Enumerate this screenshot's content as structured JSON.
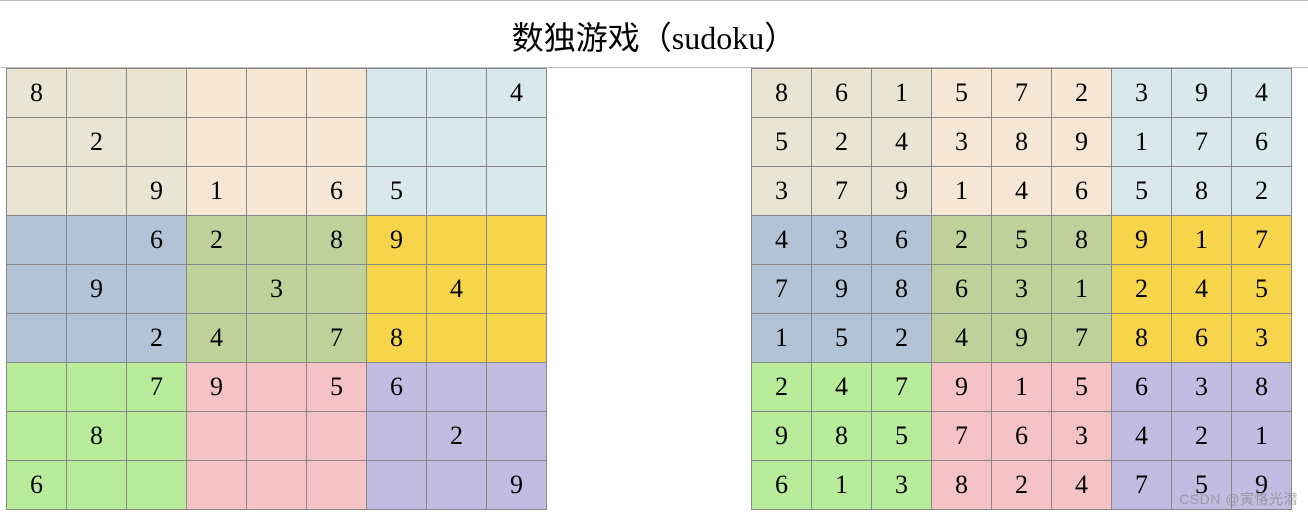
{
  "title": "数独游戏（sudoku）",
  "watermark": "CSDN @寅恪光潜",
  "colors": [
    "c0",
    "c1",
    "c2",
    "c3",
    "c4",
    "c5",
    "c6",
    "c7",
    "c8"
  ],
  "puzzle": [
    [
      "8",
      "",
      "",
      "",
      "",
      "",
      "",
      "",
      "4"
    ],
    [
      "",
      "2",
      "",
      "",
      "",
      "",
      "",
      "",
      ""
    ],
    [
      "",
      "",
      "9",
      "1",
      "",
      "6",
      "5",
      "",
      ""
    ],
    [
      "",
      "",
      "6",
      "2",
      "",
      "8",
      "9",
      "",
      ""
    ],
    [
      "",
      "9",
      "",
      "",
      "3",
      "",
      "",
      "4",
      ""
    ],
    [
      "",
      "",
      "2",
      "4",
      "",
      "7",
      "8",
      "",
      ""
    ],
    [
      "",
      "",
      "7",
      "9",
      "",
      "5",
      "6",
      "",
      ""
    ],
    [
      "",
      "8",
      "",
      "",
      "",
      "",
      "",
      "2",
      ""
    ],
    [
      "6",
      "",
      "",
      "",
      "",
      "",
      "",
      "",
      "9"
    ]
  ],
  "solution": [
    [
      "8",
      "6",
      "1",
      "5",
      "7",
      "2",
      "3",
      "9",
      "4"
    ],
    [
      "5",
      "2",
      "4",
      "3",
      "8",
      "9",
      "1",
      "7",
      "6"
    ],
    [
      "3",
      "7",
      "9",
      "1",
      "4",
      "6",
      "5",
      "8",
      "2"
    ],
    [
      "4",
      "3",
      "6",
      "2",
      "5",
      "8",
      "9",
      "1",
      "7"
    ],
    [
      "7",
      "9",
      "8",
      "6",
      "3",
      "1",
      "2",
      "4",
      "5"
    ],
    [
      "1",
      "5",
      "2",
      "4",
      "9",
      "7",
      "8",
      "6",
      "3"
    ],
    [
      "2",
      "4",
      "7",
      "9",
      "1",
      "5",
      "6",
      "3",
      "8"
    ],
    [
      "9",
      "8",
      "5",
      "7",
      "6",
      "3",
      "4",
      "2",
      "1"
    ],
    [
      "6",
      "1",
      "3",
      "8",
      "2",
      "4",
      "7",
      "5",
      "9"
    ]
  ]
}
